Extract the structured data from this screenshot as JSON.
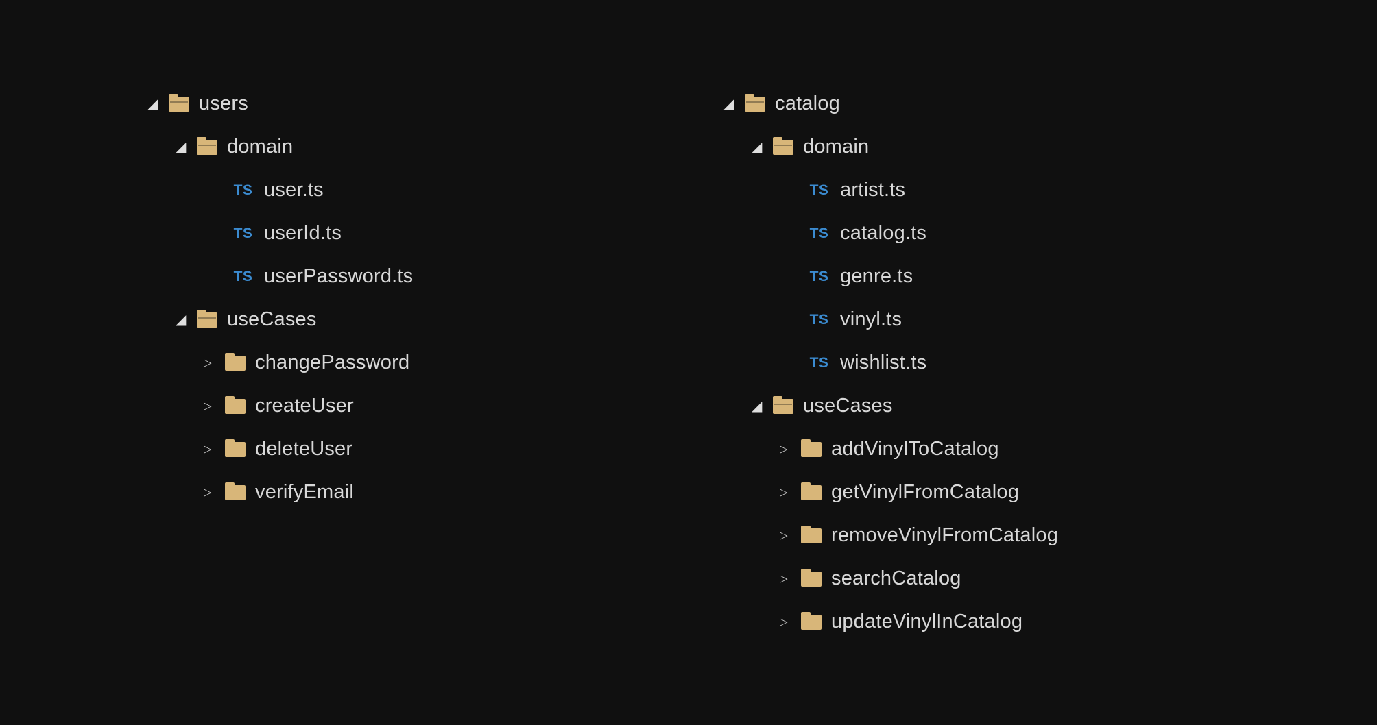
{
  "icons": {
    "ts_label": "TS"
  },
  "left": {
    "root": {
      "label": "users"
    },
    "domain": {
      "label": "domain",
      "files": [
        {
          "label": "user.ts"
        },
        {
          "label": "userId.ts"
        },
        {
          "label": "userPassword.ts"
        }
      ]
    },
    "useCases": {
      "label": "useCases",
      "folders": [
        {
          "label": "changePassword"
        },
        {
          "label": "createUser"
        },
        {
          "label": "deleteUser"
        },
        {
          "label": "verifyEmail"
        }
      ]
    }
  },
  "right": {
    "root": {
      "label": "catalog"
    },
    "domain": {
      "label": "domain",
      "files": [
        {
          "label": "artist.ts"
        },
        {
          "label": "catalog.ts"
        },
        {
          "label": "genre.ts"
        },
        {
          "label": "vinyl.ts"
        },
        {
          "label": "wishlist.ts"
        }
      ]
    },
    "useCases": {
      "label": "useCases",
      "folders": [
        {
          "label": "addVinylToCatalog"
        },
        {
          "label": "getVinylFromCatalog"
        },
        {
          "label": "removeVinylFromCatalog"
        },
        {
          "label": "searchCatalog"
        },
        {
          "label": "updateVinylInCatalog"
        }
      ]
    }
  }
}
